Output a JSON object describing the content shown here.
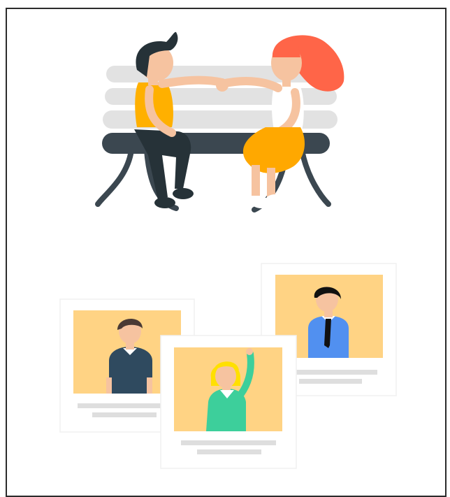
{
  "illustration": {
    "colors": {
      "frame_border": "#2b2b2b",
      "bench_slats": "#e2e2e2",
      "bench_seat": "#3b4750",
      "skin": "#f6c3a0",
      "man_hair": "#263238",
      "man_shirt": "#ffb000",
      "man_pants": "#263238",
      "woman_hair": "#ff6548",
      "woman_top": "#ffffff",
      "woman_skirt": "#ffa800",
      "card_bg": "#ffffff",
      "photo_bg": "#ffd384",
      "placeholder_line": "#dedede",
      "person1_shirt": "#2f4a5f",
      "person2_shirt": "#3dcf9b",
      "person2_hair": "#ffe000",
      "person3_shirt": "#5190f0",
      "person3_tie": "#111111"
    },
    "icons": [
      "couple-on-bench-illustration",
      "profile-cards-illustration"
    ]
  }
}
